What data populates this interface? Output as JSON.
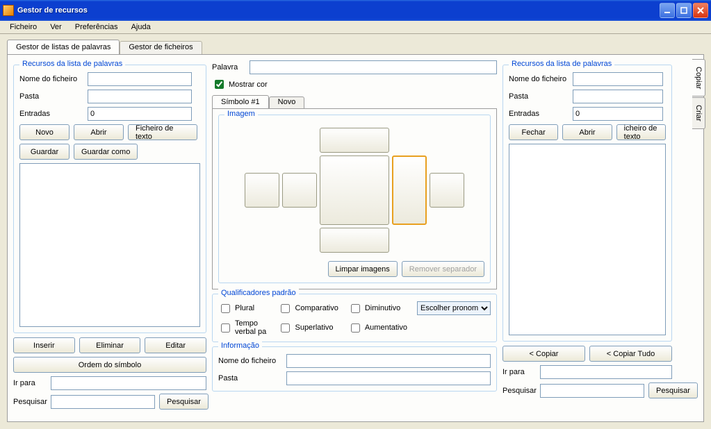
{
  "window": {
    "title": "Gestor de recursos"
  },
  "menu": {
    "file": "Ficheiro",
    "view": "Ver",
    "prefs": "Preferências",
    "help": "Ajuda"
  },
  "outerTabs": {
    "words": "Gestor de listas de palavras",
    "files": "Gestor de ficheiros"
  },
  "left": {
    "group": "Recursos da lista de palavras",
    "filename": "Nome do ficheiro",
    "folder": "Pasta",
    "entries": "Entradas",
    "entriesValue": "0",
    "new": "Novo",
    "open": "Abrir",
    "textfile": "Ficheiro de texto",
    "save": "Guardar",
    "saveas": "Guardar como",
    "insert": "Inserir",
    "delete": "Eliminar",
    "edit": "Editar",
    "symbolorder": "Ordem do símbolo",
    "goto": "Ir para",
    "search": "Pesquisar",
    "searchbtn": "Pesquisar"
  },
  "mid": {
    "word": "Palavra",
    "showcolor": "Mostrar cor",
    "symtab": "Símbolo #1",
    "newtab": "Novo",
    "imageGroup": "Imagem",
    "clear": "Limpar imagens",
    "removesep": "Remover separador",
    "qualGroup": "Qualificadores padrão",
    "plural": "Plural",
    "comparative": "Comparativo",
    "diminutive": "Diminutivo",
    "pronoun": "Escolher pronom",
    "pasttense": "Tempo verbal pa",
    "superlative": "Superlativo",
    "augmentative": "Aumentativo",
    "infoGroup": "Informação",
    "infoFilename": "Nome do ficheiro",
    "infoFolder": "Pasta"
  },
  "right": {
    "group": "Recursos da lista de palavras",
    "filename": "Nome do ficheiro",
    "folder": "Pasta",
    "entries": "Entradas",
    "entriesValue": "0",
    "close": "Fechar",
    "open": "Abrir",
    "textfile": "icheiro de texto",
    "copy": "< Copiar",
    "copyall": "< Copiar Tudo",
    "goto": "Ir para",
    "search": "Pesquisar",
    "searchbtn": "Pesquisar"
  },
  "sideTabs": {
    "copy": "Copiar",
    "create": "Criar"
  }
}
